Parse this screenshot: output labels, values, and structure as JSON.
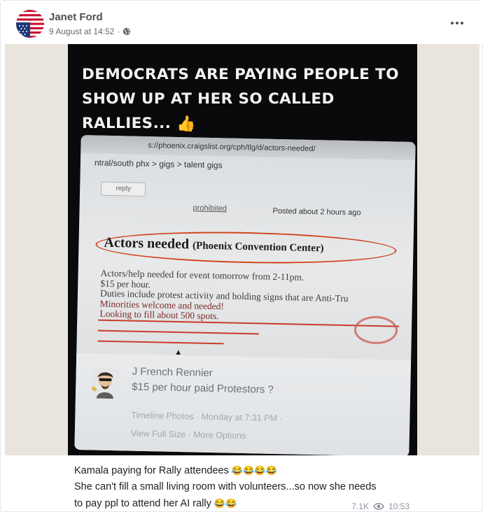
{
  "post": {
    "author": "Janet Ford",
    "date": "9 August at 14:52",
    "separator": "·"
  },
  "image": {
    "headline": "DEMOCRATS ARE PAYING PEOPLE TO SHOW UP AT HER SO CALLED RALLIES...",
    "headline_emoji": "👍",
    "url": "s://phoenix.craigslist.org/cph/tlg/d/actors-needed/",
    "breadcrumb": "ntral/south phx > gigs > talent gigs",
    "reply_label": "reply",
    "prohibited_label": "prohibited",
    "posted_text": "Posted about 2 hours ago",
    "ad_title": "Actors needed",
    "ad_location": "(Phoenix Convention Center)",
    "ad_lines": [
      "Actors/help needed for event tomorrow from 2-11pm.",
      "$15 per hour.",
      "Duties include protest activity and holding signs that are Anti-Tru",
      "Minorities welcome and needed!",
      "Looking to fill about 500 spots."
    ],
    "poster_name": "J French Rennier",
    "poster_text": "$15 per hour paid Protestors ?",
    "poster_meta": "Timeline Photos · Monday at 7:31 PM · ",
    "poster_links": "View Full Size · More Options"
  },
  "caption": {
    "line1": "Kamala paying for Rally attendees",
    "line1_emoji": "😂😂😂😂",
    "line2": "She can't fill a small living room with volunteers...so now she needs",
    "line3": "to pay ppl to attend her AI rally",
    "line3_emoji": "😂😂"
  },
  "stats": {
    "views": "7.1K",
    "duration": "10:53"
  },
  "colors": {
    "author": "#4b4f56",
    "meta": "#65676b",
    "annotation_red": "#d0451b",
    "media_background": "#e9e5dc"
  },
  "icons": [
    "us-flag-avatar-icon",
    "globe-icon",
    "more-options-icon",
    "eye-icon",
    "thumbs-up-emoji-icon",
    "laughing-emoji-icon"
  ]
}
